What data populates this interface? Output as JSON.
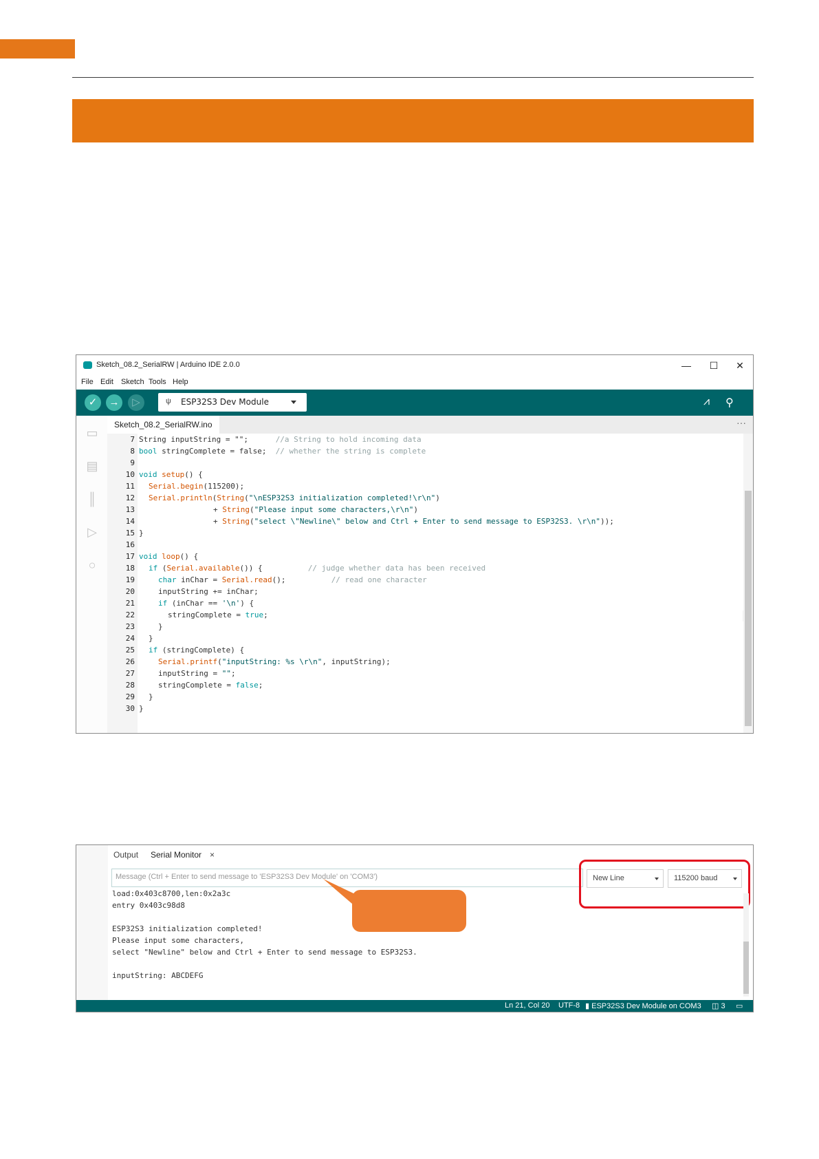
{
  "colors": {
    "brand_orange": "#e57712",
    "ide_teal": "#006468",
    "highlight_red": "#e3101e",
    "callout_orange": "#ed7d31"
  },
  "ide": {
    "window_title": "Sketch_08.2_SerialRW | Arduino IDE 2.0.0",
    "window_controls": {
      "minimize": "—",
      "maximize": "☐",
      "close": "✕"
    },
    "menu": [
      "File",
      "Edit",
      "Sketch",
      "Tools",
      "Help"
    ],
    "toolbar": {
      "verify_icon": "check-icon",
      "upload_icon": "arrow-right-icon",
      "debug_icon": "debug-icon",
      "board": "ESP32S3 Dev Module",
      "serial_plotter_icon": "plotter-icon",
      "serial_monitor_icon": "monitor-icon"
    },
    "file_tab": "Sketch_08.2_SerialRW.ino",
    "tab_more": "···",
    "side_icons": [
      "folder-icon",
      "board-manager-icon",
      "library-icon",
      "debug-icon",
      "search-icon"
    ],
    "line_numbers": [
      "7",
      "8",
      "9",
      "10",
      "11",
      "12",
      "13",
      "14",
      "15",
      "16",
      "17",
      "18",
      "19",
      "20",
      "21",
      "22",
      "23",
      "24",
      "25",
      "26",
      "27",
      "28",
      "29",
      "30"
    ]
  },
  "monitor": {
    "tabs": [
      "Output",
      "Serial Monitor"
    ],
    "close_tab": "×",
    "input_placeholder": "Message (Ctrl + Enter to send message to 'ESP32S3 Dev Module' on 'COM3')",
    "line_ending": "New Line",
    "baud": "115200 baud",
    "output_lines": [
      "load:0x403c8700,len:0x2a3c",
      "entry 0x403c98d8",
      "",
      "ESP32S3 initialization completed!",
      "Please input some characters,",
      "select \"Newline\" below and Ctrl + Enter to send message to ESP32S3.",
      "",
      "inputString: ABCDEFG"
    ],
    "status": {
      "position": "Ln 21, Col 20",
      "encoding": "UTF-8",
      "board_port": "ESP32S3 Dev Module on COM3",
      "notifications": "3"
    }
  }
}
